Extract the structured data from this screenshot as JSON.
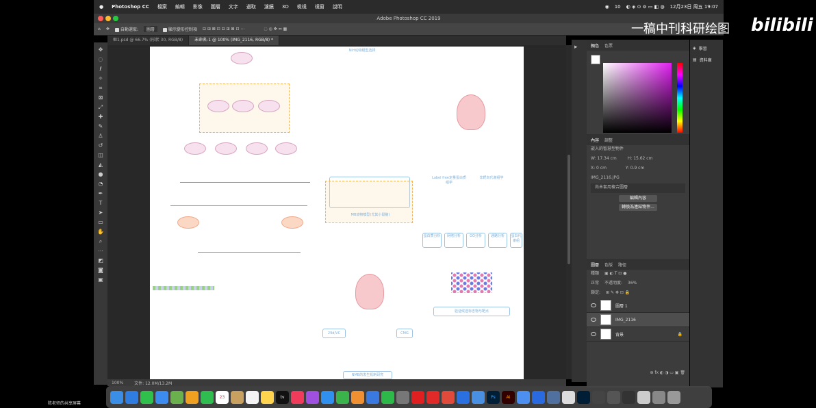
{
  "menubar": {
    "app_name": "Photoshop CC",
    "items": [
      "檔案",
      "編輯",
      "影像",
      "圖層",
      "文字",
      "選取",
      "濾鏡",
      "3D",
      "檢視",
      "視窗",
      "說明"
    ],
    "status": [
      "10"
    ],
    "datetime": "12月23日 周五 19:07"
  },
  "window": {
    "title": "Adobe Photoshop CC 2019"
  },
  "optionsbar": {
    "auto_select_label": "自動選取:",
    "auto_select_value": "圖層",
    "show_transform_label": "顯示變形控制項"
  },
  "tabs": [
    {
      "label": "框1.psd @ 66.7% (形狀 30, RGB/8)"
    },
    {
      "label": "未命名-1 @ 100% (IMG_2116, RGB/8) *"
    }
  ],
  "statusbar": {
    "zoom": "100%",
    "doc": "文件: 12.0M/13.2M"
  },
  "panels": {
    "color_tabs": [
      "顏色",
      "色票"
    ],
    "props_tabs": [
      "內容",
      "調整"
    ],
    "props_title": "嵌入的智慧型物件",
    "w": "W: 17.34 cm",
    "h": "H: 15.62 cm",
    "x": "X: 0 cm",
    "y": "Y: 0.9 cm",
    "filename": "IMG_2116.JPG",
    "filename_placeholder": "尚未套用複合圖層",
    "edit_btn": "編輯內容",
    "convert_btn": "轉換為連結物件...",
    "layers_tabs": [
      "圖層",
      "色版",
      "路徑"
    ],
    "kind": "種類",
    "blend": "正常",
    "opacity_label": "不透明度:",
    "opacity": "36%",
    "lock_label": "鎖定:",
    "layers": [
      "圖層 1",
      "IMG_2116",
      "背景"
    ]
  },
  "farright": {
    "items": [
      "學習",
      "資料庫"
    ]
  },
  "watermark": {
    "text": "一稿中刊科研绘图",
    "logo": "bilibili"
  },
  "share_label": "陈老师的共享屏幕",
  "dock": {
    "date_icon": "23",
    "tv_label": "tv",
    "ps_label": "Ps",
    "ai_label": "Ai"
  },
  "canvas": {
    "title_top": "NIH动物模型选择",
    "right_label_1": "Label free定量蛋白质组学",
    "right_label_2": "非靶向代谢组学",
    "center_box": "MB动物模型(尤其小鼠脑)",
    "bottom_left_box": "29d/VC",
    "bottom_right_box": "CMG",
    "bottom_center": "NMB的发生机制研究",
    "results": [
      "蛋白质分析",
      "网络分析",
      "GO分析",
      "通路分析",
      "蛋白代谢组"
    ],
    "right_bottom": "验证候选标志物与靶点"
  }
}
